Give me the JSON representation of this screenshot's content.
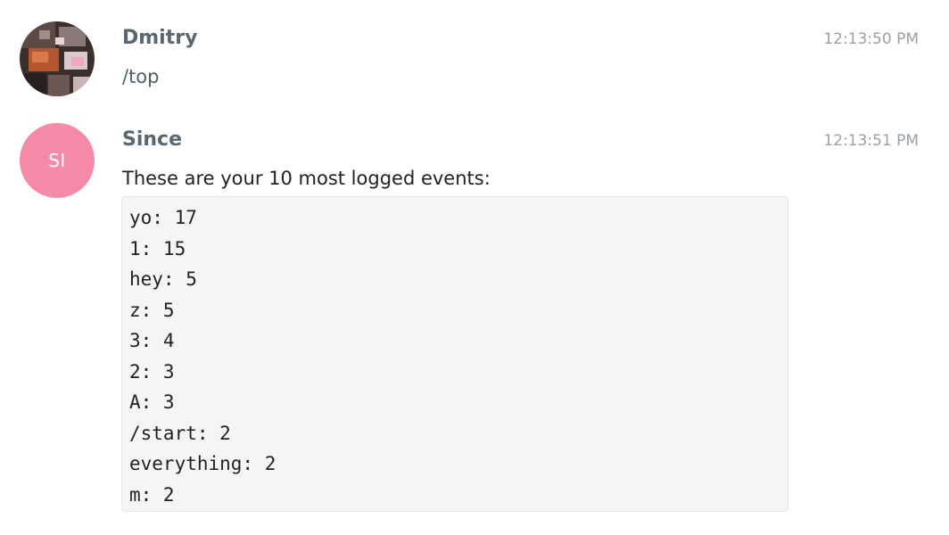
{
  "colors": {
    "sender_name": "#5b6770",
    "timestamp": "#9aa0a4",
    "avatar_since_bg": "#f58ba9",
    "code_bg": "#f5f5f5"
  },
  "messages": [
    {
      "sender": "Dmitry",
      "time": "12:13:50 PM",
      "avatar": {
        "type": "photo"
      },
      "text": "/top"
    },
    {
      "sender": "Since",
      "time": "12:13:51 PM",
      "avatar": {
        "type": "initials",
        "initials": "SI"
      },
      "text": "These are your 10 most logged events:",
      "code_lines": [
        "yo: 17",
        "1: 15",
        "hey: 5",
        "z: 5",
        "3: 4",
        "2: 3",
        "A: 3",
        "/start: 2",
        "everything: 2",
        "m: 2"
      ]
    }
  ]
}
